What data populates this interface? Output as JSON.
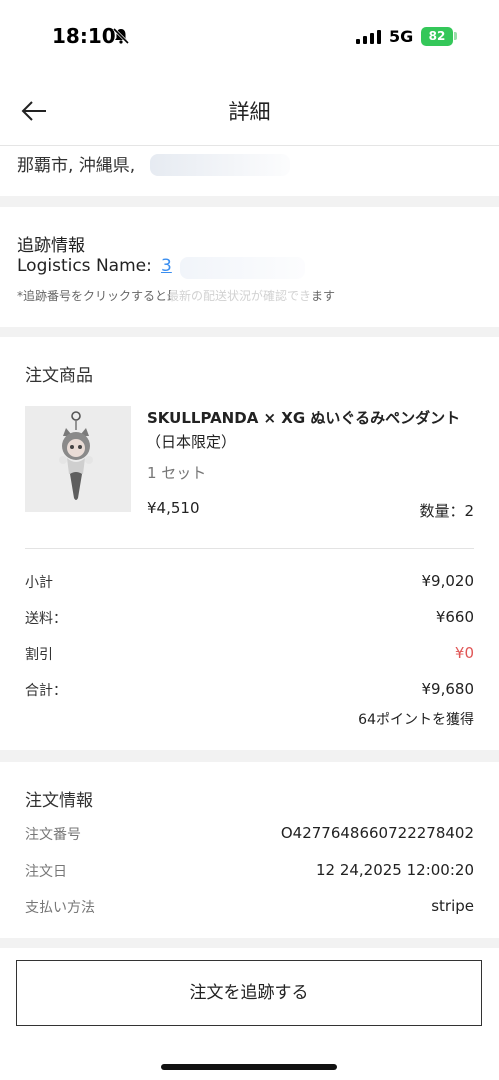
{
  "status_bar": {
    "time": "18:10",
    "network": "5G",
    "battery": "82"
  },
  "header": {
    "title": "詳細"
  },
  "address": {
    "text": "那覇市, 沖縄県,"
  },
  "tracking": {
    "title": "追跡情報",
    "logistics_label": "Logistics Name:",
    "logistics_value": "3",
    "note": "*追跡番号をクリックすると最新の配送状況が確認できます"
  },
  "products": {
    "title": "注文商品",
    "item": {
      "name": "SKULLPANDA × XG ぬいぐるみペンダント",
      "name_sub": "（日本限定）",
      "variant": "1 セット",
      "price": "¥4,510",
      "quantity": "数量：2"
    },
    "summary": [
      {
        "label": "小計",
        "value": "¥9,020"
      },
      {
        "label": "送料：",
        "value": "¥660"
      },
      {
        "label": "割引",
        "value": "¥0"
      },
      {
        "label": "合計：",
        "value": "¥9,680"
      }
    ],
    "points": "64ポイントを獲得"
  },
  "order_info": {
    "title": "注文情報",
    "rows": [
      {
        "label": "注文番号",
        "value": "O4277648660722278402"
      },
      {
        "label": "注文日",
        "value": "12 24,2025 12:00:20"
      },
      {
        "label": "支払い方法",
        "value": "stripe"
      }
    ]
  },
  "footer": {
    "track_button": "注文を追跡する"
  },
  "colors": {
    "link": "#3a8ef0",
    "discount": "#e05555",
    "battery": "#34c759"
  }
}
